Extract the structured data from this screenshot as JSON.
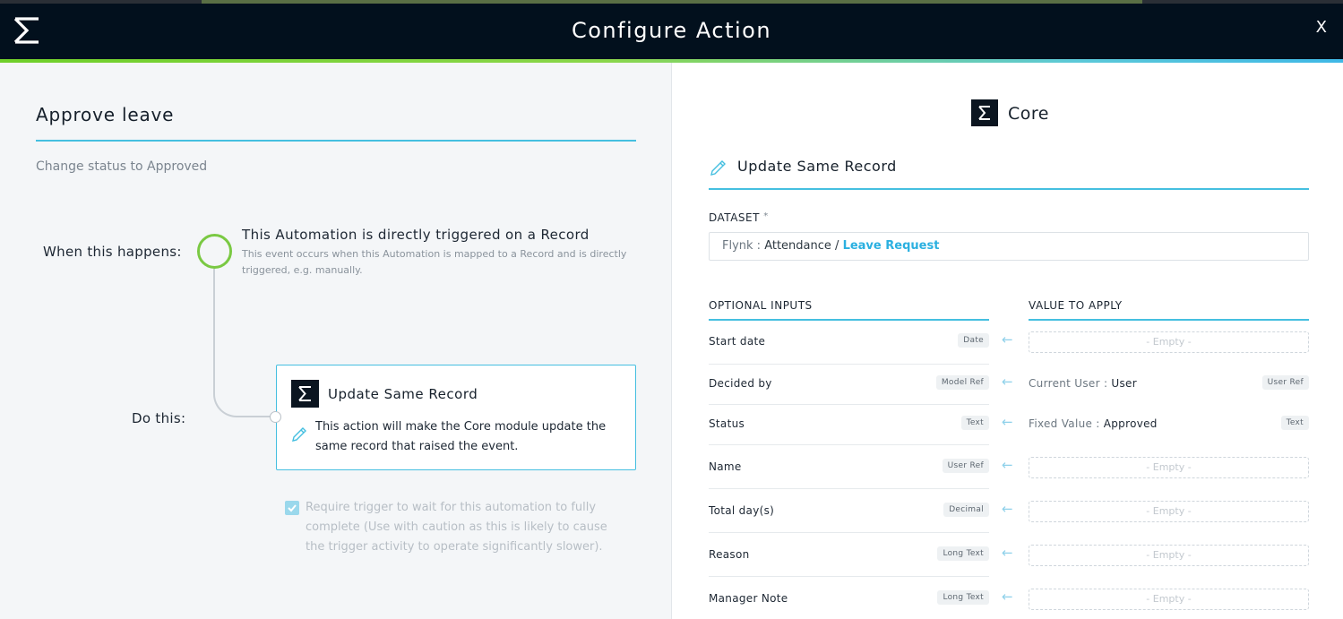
{
  "header": {
    "title": "Configure Action",
    "close_label": "X"
  },
  "left": {
    "title": "Approve leave",
    "subtitle": "Change status to Approved",
    "when_label": "When this happens:",
    "do_label": "Do this:",
    "trigger": {
      "title": "This Automation is directly triggered on a Record",
      "description": "This event occurs when this Automation is mapped to a Record and is directly triggered, e.g. manually."
    },
    "action": {
      "title": "Update Same Record",
      "description": "This action will make the Core module update the same record that raised the event."
    },
    "wait_checkbox": {
      "checked": true,
      "label": "Require trigger to wait for this automation to fully complete (Use with caution as this is likely to cause the trigger activity to operate significantly slower)."
    }
  },
  "right": {
    "module": "Core",
    "action_title": "Update Same Record",
    "dataset": {
      "label": "DATASET",
      "required_mark": "*",
      "prefix": "Flynk :",
      "middle": "Attendance /",
      "link": "Leave Request"
    },
    "optional_inputs_header": "OPTIONAL INPUTS",
    "value_to_apply_header": "VALUE TO APPLY",
    "rows": [
      {
        "name": "Start date",
        "type": "Date",
        "empty": "- Empty -"
      },
      {
        "name": "Decided by",
        "type": "Model Ref",
        "value_label": "Current User :",
        "value": "User",
        "value_type": "User Ref"
      },
      {
        "name": "Status",
        "type": "Text",
        "value_label": "Fixed Value :",
        "value": "Approved",
        "value_type": "Text"
      },
      {
        "name": "Name",
        "type": "User Ref",
        "empty": "- Empty -"
      },
      {
        "name": "Total day(s)",
        "type": "Decimal",
        "empty": "- Empty -"
      },
      {
        "name": "Reason",
        "type": "Long Text",
        "empty": "- Empty -"
      },
      {
        "name": "Manager Note",
        "type": "Long Text",
        "empty": "- Empty -"
      }
    ],
    "arrow_glyph": "←"
  },
  "colors": {
    "header_bg": "#02101d",
    "accent_blue": "#45bfe0",
    "trigger_green": "#7ac943",
    "link_blue": "#2bb0e0"
  }
}
